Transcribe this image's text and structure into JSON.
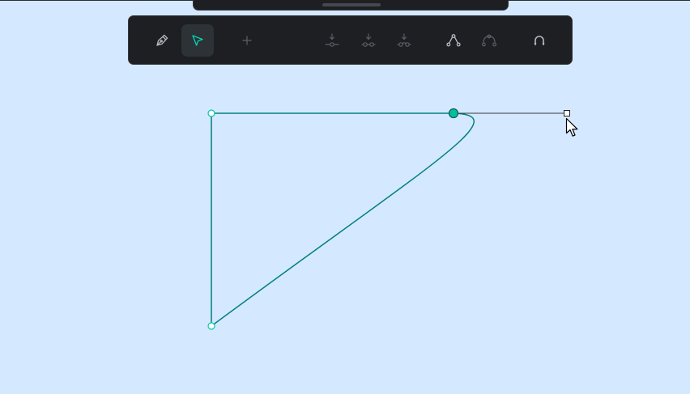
{
  "colors": {
    "canvas_background": "#d4e8ff",
    "toolbar_background": "#1d1f22",
    "accent": "#00d6b4",
    "path_stroke": "#00807f",
    "handle_line": "#3a3a3a",
    "icon_default": "#b5bac1",
    "icon_disabled": "#5b6066"
  },
  "toolbar": {
    "tools": [
      {
        "name": "pen-tool",
        "icon": "pen-icon",
        "state": "enabled"
      },
      {
        "name": "path-select-tool",
        "icon": "select-arrow-icon",
        "state": "active"
      },
      {
        "name": "add-node-tool",
        "icon": "plus-icon",
        "state": "disabled"
      },
      {
        "name": "make-node-corner",
        "icon": "node-corner-icon",
        "state": "disabled"
      },
      {
        "name": "make-node-smooth",
        "icon": "node-smooth-icon",
        "state": "disabled"
      },
      {
        "name": "make-node-symmetric",
        "icon": "node-symmetric-icon",
        "state": "disabled"
      },
      {
        "name": "curve-node",
        "icon": "curve-node-icon",
        "state": "enabled"
      },
      {
        "name": "delete-curve-node",
        "icon": "curve-node-remove-icon",
        "state": "disabled"
      },
      {
        "name": "snap-toggle",
        "icon": "magnet-icon",
        "state": "enabled"
      }
    ]
  },
  "canvas": {
    "shape": "closed-path",
    "node_count": 3,
    "selected_node": "top-right-node",
    "handle": "bezier-handle"
  }
}
